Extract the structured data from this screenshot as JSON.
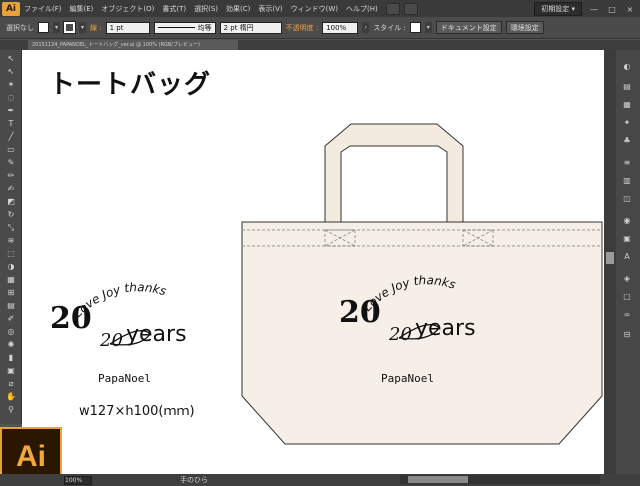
{
  "app": {
    "logo_small": "Ai",
    "logo_big": "Ai",
    "brand_color": "#e8a23a"
  },
  "menu": [
    "ファイル(F)",
    "編集(E)",
    "オブジェクト(O)",
    "書式(T)",
    "選択(S)",
    "効果(C)",
    "表示(V)",
    "ウィンドウ(W)",
    "ヘルプ(H)"
  ],
  "workspace": {
    "label": "初期設定",
    "dropdown": "▾"
  },
  "window_buttons": {
    "minimize": "—",
    "maximize": "□",
    "close": "×"
  },
  "controlbar": {
    "selection": "選択なし",
    "stroke_label": "線 :",
    "stroke_value": "1 pt",
    "line_style": "均等",
    "brush": "2 pt 楕円",
    "opacity_label": "不透明度 :",
    "opacity_value": "100%",
    "style_label": "スタイル :",
    "document_settings": "ドキュメント設定",
    "preferences": "環境設定"
  },
  "document_tab": {
    "title": "20151124_PAPANOEL_トートバッグ_ver.ai @ 100% (RGB/プレビュー)"
  },
  "artboard": {
    "title": "トートバッグ",
    "size_label": "w127×h100(ｍｍ)",
    "logo": {
      "arc_text": "Love Joy thanks",
      "number_big": "20",
      "number_small": "20",
      "years": "years",
      "brand": "PapaNoel"
    }
  },
  "colors": {
    "bag_fill": "#f6efe7",
    "bag_stroke": "#333333",
    "handle_fill": "#f3ebe0"
  },
  "status": {
    "zoom": "100%",
    "tool": "手のひら"
  }
}
